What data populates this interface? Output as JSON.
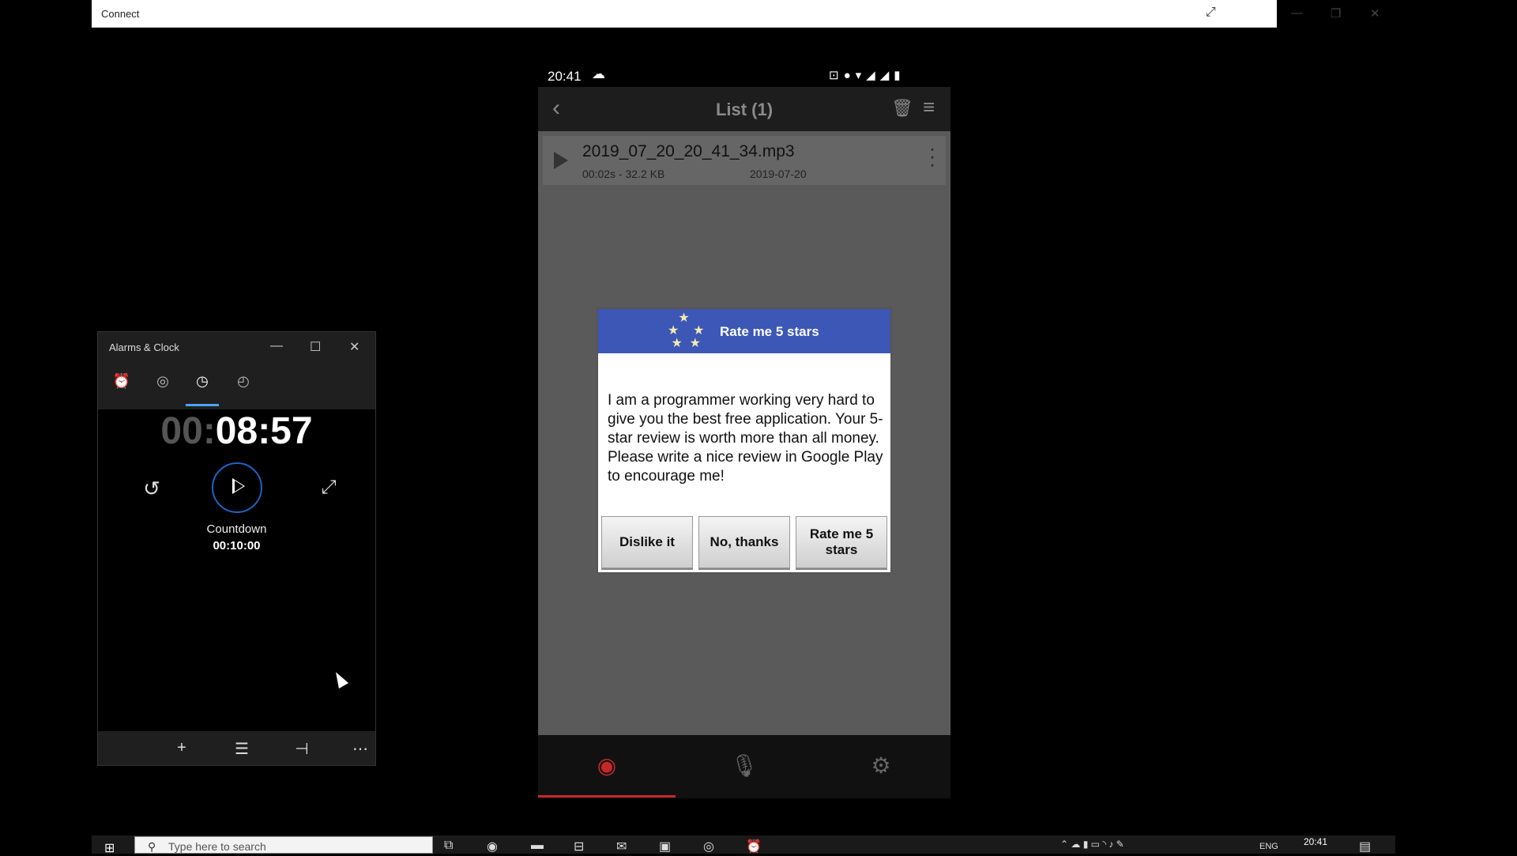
{
  "connect": {
    "title": "Connect"
  },
  "clock": {
    "title": "Alarms & Clock",
    "timer_dim": "00:",
    "timer_main": "08:57",
    "countdown_label": "Countdown",
    "countdown_value": "00:10:00"
  },
  "phone": {
    "status_time": "20:41",
    "list_title": "List (1)",
    "item": {
      "name": "2019_07_20_20_41_34.mp3",
      "meta": "00:02s - 32.2 KB",
      "date": "2019-07-20"
    }
  },
  "dialog": {
    "title": "Rate me 5 stars",
    "body": "I am a programmer working very hard to give you the best free application. Your 5-star review is worth more than all money. Please write a nice review in Google Play to encourage me!",
    "btn_dislike": "Dislike it",
    "btn_no": "No, thanks",
    "btn_rate": "Rate me 5 stars"
  },
  "taskbar": {
    "search_placeholder": "Type here to search",
    "lang": "ENG",
    "time": "20:41"
  },
  "colors": {
    "dialog_header": "#3c57b5",
    "timer_ring": "#1e63c7",
    "nav_active": "#c62828"
  }
}
